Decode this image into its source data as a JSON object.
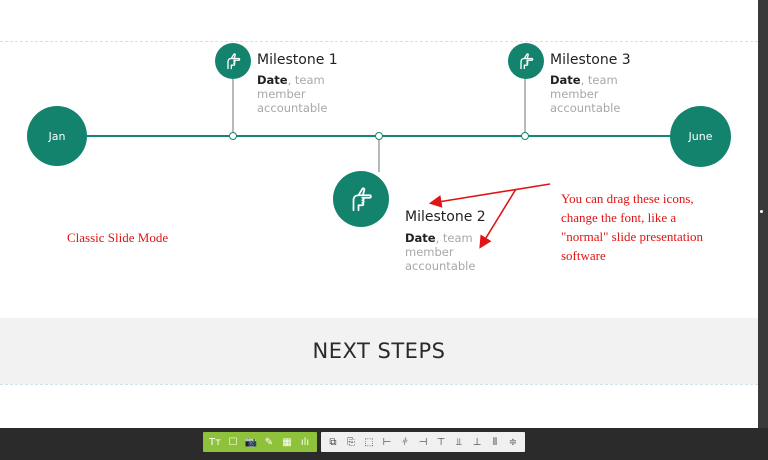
{
  "timeline": {
    "start_label": "Jan",
    "end_label": "June",
    "milestones": [
      {
        "title": "Milestone 1",
        "date_label": "Date",
        "desc_line1": ", team",
        "desc_line2": "member",
        "desc_line3": "accountable"
      },
      {
        "title": "Milestone 2",
        "date_label": "Date",
        "desc_line1": ", team",
        "desc_line2": "member",
        "desc_line3": "accountable"
      },
      {
        "title": "Milestone 3",
        "date_label": "Date",
        "desc_line1": ", team",
        "desc_line2": "member",
        "desc_line3": "accountable"
      }
    ]
  },
  "annotations": {
    "mode_label": "Classic Slide Mode",
    "drag_note_line1": "You can drag these icons,",
    "drag_note_line2": "change the font, like a",
    "drag_note_line3": "\"normal\" slide presentation",
    "drag_note_line4": "software"
  },
  "next_steps": {
    "title": "NEXT STEPS"
  },
  "toolbar": {
    "insert_tools": [
      {
        "icon": "text-icon",
        "glyph": "Tт"
      },
      {
        "icon": "shape-icon",
        "glyph": "☐"
      },
      {
        "icon": "camera-icon",
        "glyph": "📷"
      },
      {
        "icon": "pen-icon",
        "glyph": "✎"
      },
      {
        "icon": "table-icon",
        "glyph": "▦"
      },
      {
        "icon": "chart-icon",
        "glyph": "ılı"
      }
    ],
    "arrange_tools": [
      {
        "icon": "bring-front-icon",
        "glyph": "⧉"
      },
      {
        "icon": "duplicate-icon",
        "glyph": "⎘"
      },
      {
        "icon": "send-back-icon",
        "glyph": "⬚"
      },
      {
        "icon": "align-left-icon",
        "glyph": "⊢"
      },
      {
        "icon": "align-center-h-icon",
        "glyph": "⫩"
      },
      {
        "icon": "align-right-icon",
        "glyph": "⊣"
      },
      {
        "icon": "align-top-icon",
        "glyph": "⊤"
      },
      {
        "icon": "align-middle-v-icon",
        "glyph": "⫫"
      },
      {
        "icon": "align-bottom-icon",
        "glyph": "⊥"
      },
      {
        "icon": "distribute-h-icon",
        "glyph": "⫴"
      },
      {
        "icon": "distribute-v-icon",
        "glyph": "≑"
      }
    ]
  },
  "colors": {
    "accent": "#14836d",
    "annotation": "#e01414",
    "toolbar_green": "#8fc23b"
  }
}
